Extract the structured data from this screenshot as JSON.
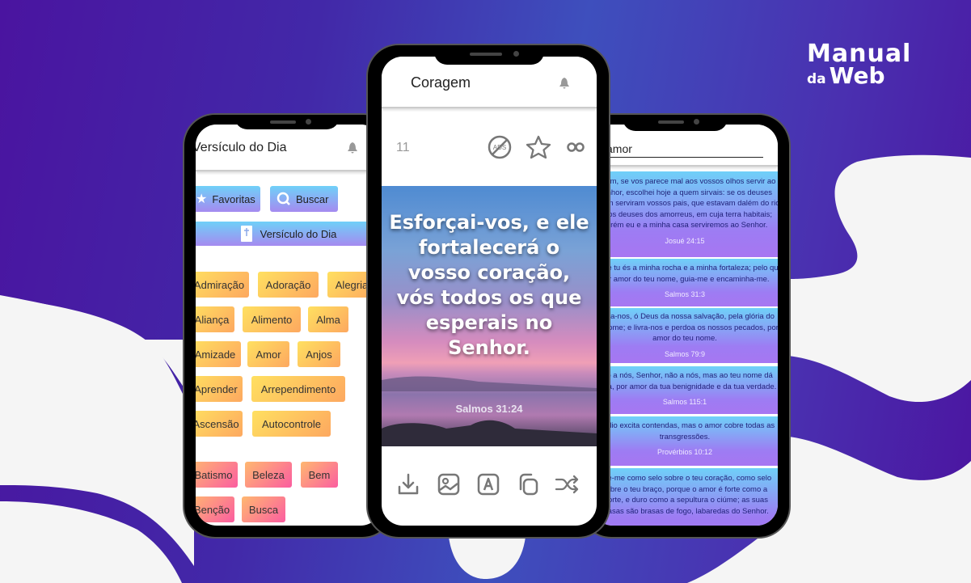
{
  "brand": {
    "line1": "Manual",
    "line2_small": "da",
    "line2_big": "Web"
  },
  "phone_left": {
    "title": "Versículo do Dia",
    "bell_icon": "bell-icon",
    "buttons": [
      {
        "label": "Favoritas",
        "icon": "star-icon"
      },
      {
        "label": "Buscar",
        "icon": "search-icon"
      }
    ],
    "verse_of_day_button": {
      "label": "Versículo do Dia",
      "icon": "bible-icon"
    },
    "tags_group_a": [
      "Admiração",
      "Adoração",
      "Alegria",
      "Aliança",
      "Alimento",
      "Alma",
      "Amizade",
      "Amor",
      "Anjos",
      "Aprender",
      "Arrependimento",
      "Ascensão",
      "Autocontrole"
    ],
    "tags_group_b": [
      "Batismo",
      "Beleza",
      "Bem",
      "Benção",
      "Busca"
    ],
    "colors": {
      "tag_yellow": "#ffe060",
      "tag_orange": "#fda860",
      "tag_pink": "#fb5da0",
      "button_cyan": "#6fd0f8",
      "button_violet": "#a58af0"
    }
  },
  "phone_center": {
    "title": "Coragem",
    "counter": "11",
    "toolbar_icons": [
      "no-ads-icon",
      "star-icon",
      "share-icon"
    ],
    "verse_lines": [
      "Esforçai-vos, e ele",
      "fortalecerá o",
      "vosso coração,",
      "vós todos os que",
      "esperais no",
      "Senhor."
    ],
    "verse_reference": "Salmos 31:24",
    "bottom_actions": [
      {
        "name": "download-icon"
      },
      {
        "name": "image-icon"
      },
      {
        "name": "font-icon"
      },
      {
        "name": "copy-icon"
      },
      {
        "name": "shuffle-icon"
      }
    ]
  },
  "phone_right": {
    "search_value": "amor",
    "results": [
      {
        "lines": [
          "Porém, se vos parece mal aos vossos olhos servir ao",
          "Senhor, escolhei hoje a quem sirvais: se os deuses",
          "a quem serviram vossos pais, que estavam dalém do rio,",
          "ou os deuses dos amorreus, em cuja terra habitais;",
          "porém eu e a minha casa serviremos ao Senhor."
        ],
        "ref": "Josué 24:15"
      },
      {
        "lines": [
          "Porque tu és a minha rocha e a minha fortaleza; pelo que,",
          "por amor do teu nome, guia-me e encaminha-me."
        ],
        "ref": "Salmos 31:3"
      },
      {
        "lines": [
          "Ajuda-nos, ó Deus da nossa salvação, pela glória do",
          "teu nome; e livra-nos e perdoa os nossos pecados, por",
          "amor do teu nome."
        ],
        "ref": "Salmos 79:9"
      },
      {
        "lines": [
          "Não a nós, Senhor, não a nós, mas ao teu nome dá",
          "glória, por amor da tua benignidade e da tua verdade."
        ],
        "ref": "Salmos 115:1"
      },
      {
        "lines": [
          "O ódio excita contendas, mas o amor cobre todas as",
          "transgressões."
        ],
        "ref": "Provérbios 10:12"
      },
      {
        "lines": [
          "Põe-me como selo sobre o teu coração, como selo",
          "sobre o teu braço, porque o amor é forte como a",
          "morte, e duro como a sepultura o ciúme; as suas",
          "brasas são brasas de fogo, labaredas do Senhor."
        ],
        "ref": ""
      }
    ],
    "text_color": "#22227a"
  }
}
